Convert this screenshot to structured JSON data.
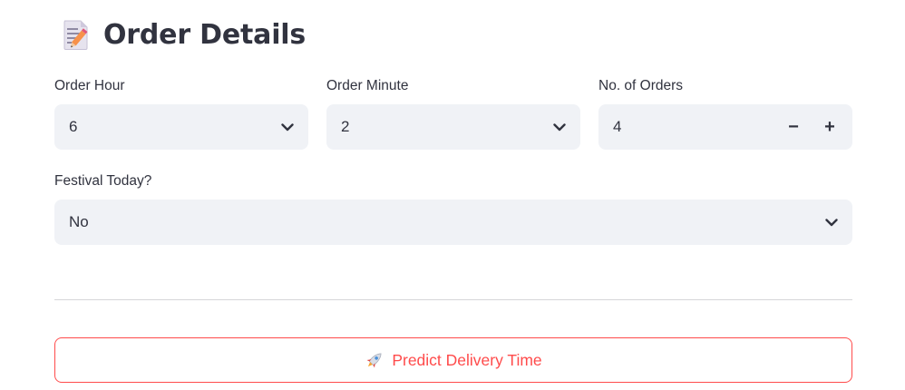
{
  "header": {
    "icon": "memo-icon",
    "title": "Order Details"
  },
  "form": {
    "order_hour": {
      "label": "Order Hour",
      "value": "6"
    },
    "order_minute": {
      "label": "Order Minute",
      "value": "2"
    },
    "num_orders": {
      "label": "No. of Orders",
      "value": "4",
      "minus": "−",
      "plus": "+"
    },
    "festival": {
      "label": "Festival Today?",
      "value": "No"
    }
  },
  "actions": {
    "predict_label": "Predict Delivery Time",
    "predict_icon": "rocket-icon"
  },
  "colors": {
    "accent": "#ff4b4b",
    "input_bg": "#f0f2f6",
    "text": "#31333f"
  }
}
